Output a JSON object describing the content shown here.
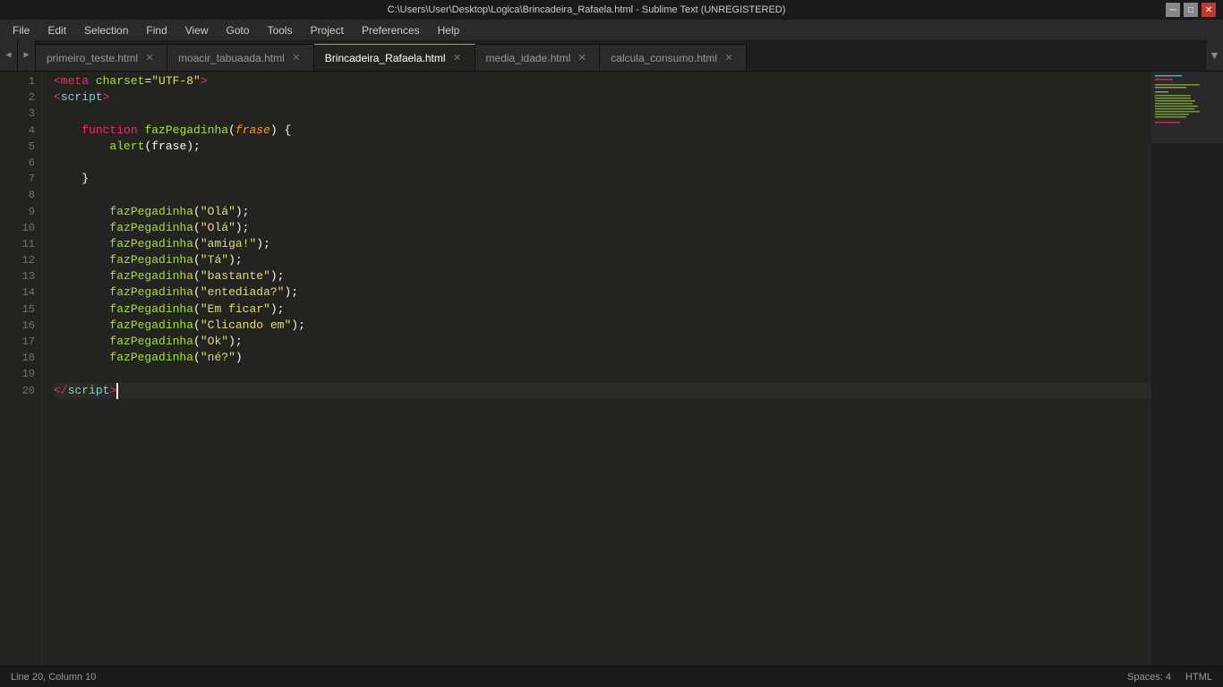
{
  "titlebar": {
    "text": "C:\\Users\\User\\Desktop\\Logica\\Brincadeira_Rafaela.html - Sublime Text (UNREGISTERED)"
  },
  "menu": {
    "items": [
      "File",
      "Edit",
      "Selection",
      "Find",
      "View",
      "Goto",
      "Tools",
      "Project",
      "Preferences",
      "Help"
    ]
  },
  "tabs": [
    {
      "label": "primeiro_teste.html",
      "active": false
    },
    {
      "label": "moacir_tabuaada.html",
      "active": false
    },
    {
      "label": "Brincadeira_Rafaela.html",
      "active": true
    },
    {
      "label": "media_idade.html",
      "active": false
    },
    {
      "label": "calcula_consumo.html",
      "active": false
    }
  ],
  "lines": [
    1,
    2,
    3,
    4,
    5,
    6,
    7,
    8,
    9,
    10,
    11,
    12,
    13,
    14,
    15,
    16,
    17,
    18,
    19,
    20
  ],
  "status": {
    "position": "Line 20, Column 10",
    "spaces": "Spaces: 4",
    "syntax": "HTML"
  }
}
